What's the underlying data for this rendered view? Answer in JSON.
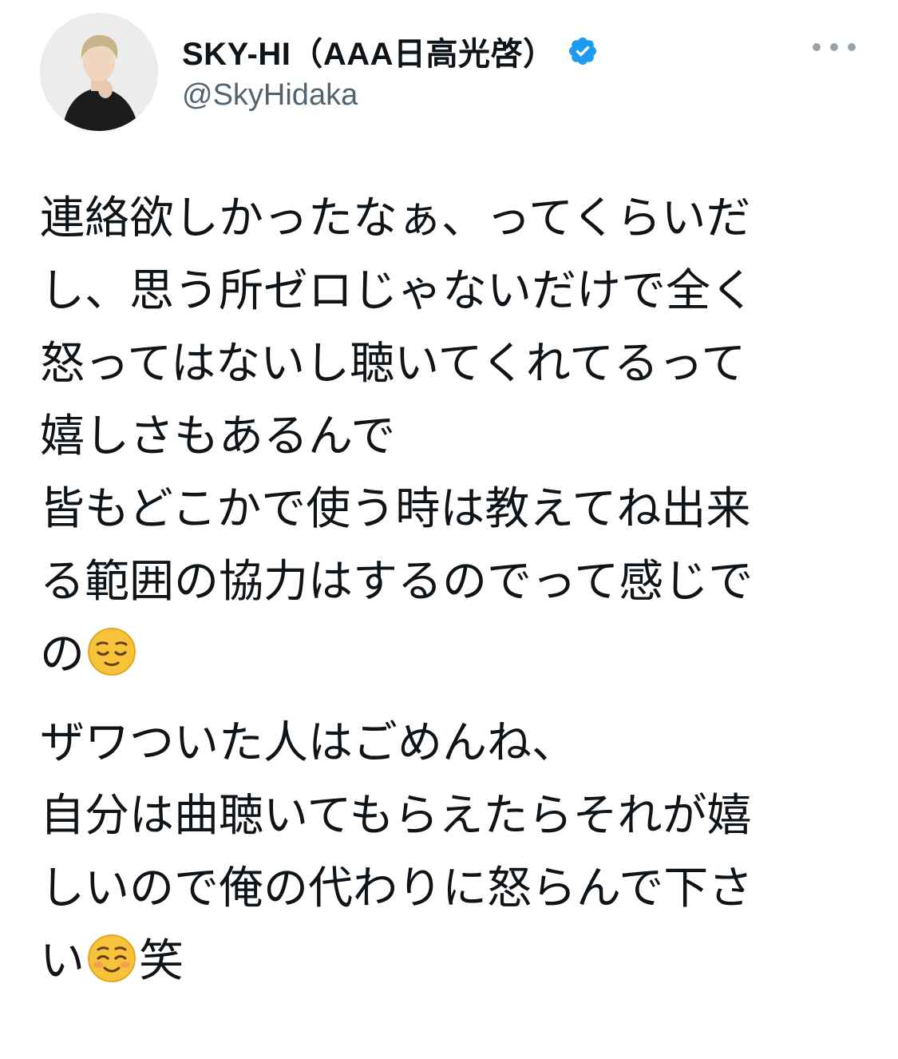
{
  "tweet": {
    "author": {
      "display_name": "SKY-HI（AAA日高光啓）",
      "handle": "@SkyHidaka",
      "verified_icon": "verified-badge-icon",
      "avatar_icon": "profile-avatar"
    },
    "more_icon": "more-options-icon",
    "accent_color": "#1d9bf0",
    "paragraphs": [
      {
        "lines": [
          "連絡欲しかったなぁ、ってくらいだ",
          "し、思う所ゼロじゃないだけで全く",
          "怒ってはないし聴いてくれてるって",
          "嬉しさもあるんで",
          "皆もどこかで使う時は教えてね出来",
          "る範囲の協力はするのでって感じで",
          "の"
        ],
        "trailing_emoji": "relieved-face-emoji"
      },
      {
        "lines": [
          "ザワついた人はごめんね、",
          "自分は曲聴いてもらえたらそれが嬉",
          "しいので俺の代わりに怒らんで下さ",
          "い"
        ],
        "trailing_emoji": "smiling-face-emoji",
        "after_emoji": "笑"
      }
    ]
  }
}
